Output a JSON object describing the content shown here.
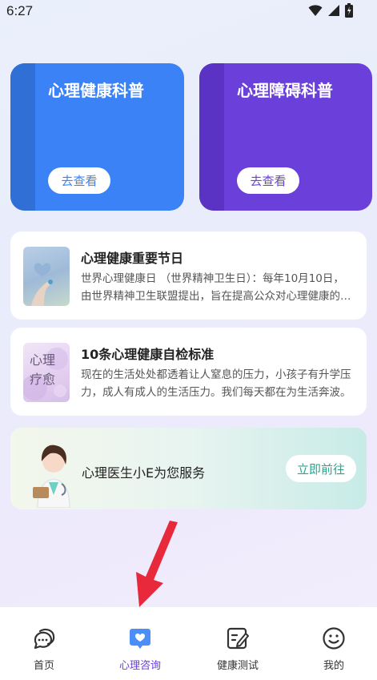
{
  "status_bar": {
    "time": "6:27"
  },
  "cards": [
    {
      "title": "心理健康科普",
      "button": "去查看",
      "color": "#3a82f5"
    },
    {
      "title": "心理障碍科普",
      "button": "去查看",
      "color": "#6b3fd9"
    }
  ],
  "articles": [
    {
      "title": "心理健康重要节日",
      "body": "世界心理健康日 （世界精神卫生日）：每年10月10日，由世界精神卫生联盟提出，旨在提高公众对心理健康的关注。",
      "thumb_text": ""
    },
    {
      "title": "10条心理健康自检标准",
      "body": "现在的生活处处都透着让人窒息的压力，小孩子有升学压力，成人有成人的生活压力。我们每天都在为生活奔波。",
      "thumb_text": "心理疗愈"
    }
  ],
  "doctor": {
    "text": "心理医生小E为您服务",
    "button": "立即前往"
  },
  "tabs": [
    {
      "label": "首页",
      "icon": "chat-bubbles-icon",
      "active": false
    },
    {
      "label": "心理咨询",
      "icon": "heart-chat-icon",
      "active": true
    },
    {
      "label": "健康测试",
      "icon": "edit-note-icon",
      "active": false
    },
    {
      "label": "我的",
      "icon": "smiley-icon",
      "active": false
    }
  ],
  "colors": {
    "accent": "#6b3fd9",
    "primary": "#3a82f5",
    "annotation_arrow": "#e8293b"
  }
}
